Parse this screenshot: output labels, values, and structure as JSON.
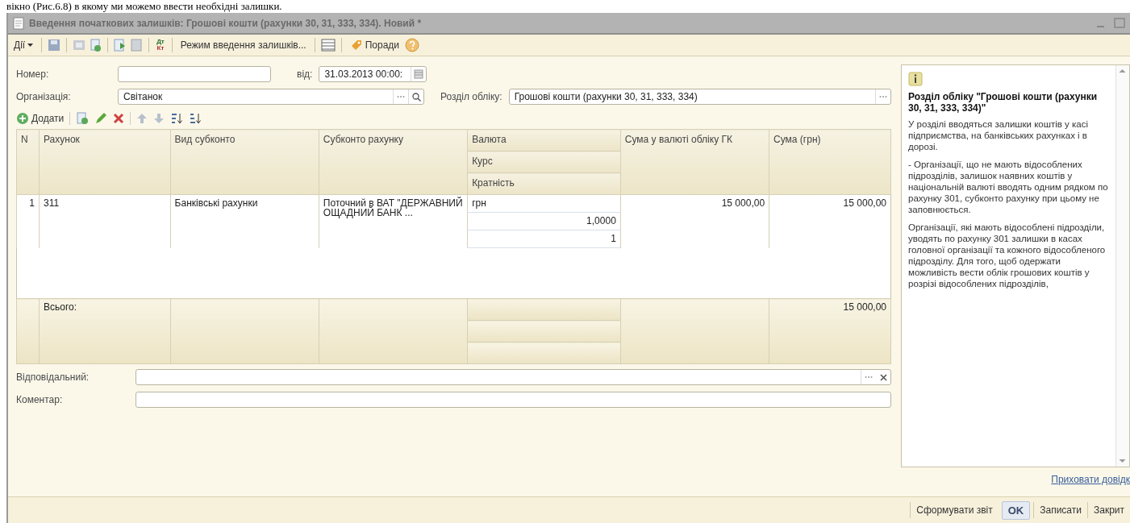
{
  "caption_text": "вікно (Рис.6.8) в якому ми можемо ввести необхідні залишки.",
  "window": {
    "title": "Введення початкових залишків: Грошові кошти (рахунки 30, 31, 333, 334). Новий *"
  },
  "toolbar": {
    "actions_menu": "Дії",
    "debit_credit": {
      "top": "Дт",
      "bottom": "Кт"
    },
    "mode_button": "Режим введення залишків...",
    "tips_button": "Поради"
  },
  "form": {
    "number": {
      "label": "Номер:"
    },
    "date": {
      "label": "від:",
      "value": "31.03.2013 00:00:"
    },
    "organization": {
      "label": "Організація:",
      "value": "Світанок"
    },
    "section": {
      "label": "Розділ обліку:",
      "value": "Грошові кошти (рахунки 30, 31, 333, 334)"
    },
    "add_button": "Додати",
    "table": {
      "columns": [
        {
          "label": "N"
        },
        {
          "label": "Рахунок"
        },
        {
          "label": "Вид субконто"
        },
        {
          "label": "Субконто рахунку"
        },
        {
          "label": "Валюта",
          "sublabels": [
            "Курс",
            "Кратність"
          ]
        },
        {
          "label": "Сума у валюті обліку ГК"
        },
        {
          "label": "Сума (грн)"
        }
      ],
      "rows": [
        {
          "n": "1",
          "account": "311",
          "subconto_kind": "Банківські рахунки",
          "subconto": "Поточний в ВАТ \"ДЕРЖАВНИЙ ОЩАДНИЙ БАНК ...",
          "currency": "грн",
          "rate": "1,0000",
          "multiplicity": "1",
          "amount_gk": "15 000,00",
          "amount_uah": "15 000,00"
        }
      ],
      "totals": {
        "label": "Всього:",
        "amount_uah": "15 000,00"
      }
    },
    "responsible": {
      "label": "Відповідальний:"
    },
    "comment": {
      "label": "Коментар:"
    }
  },
  "help": {
    "title": "Розділ обліку \"Грошові кошти (рахунки 30, 31, 333, 334)\"",
    "paragraphs": [
      "У розділі вводяться залишки коштів у касі підприємства, на банківських рахунках і в дорозі.",
      "- Організації, що не мають відособлених підрозділів, залишок наявних коштів у національній валюті вводять одним рядком по рахунку 301, субконто рахунку при цьому не заповнюється.",
      "Організації, які мають відособлені підрозділи, уводять по рахунку 301 залишки в касах головної організації та кожного відособленого підрозділу. Для того, щоб одержати можливість вести облік грошових коштів у розрізі відособлених підрозділів,"
    ],
    "hide_link": "Приховати довідк"
  },
  "footer": {
    "buttons": [
      {
        "label": "Сформувати звіт",
        "kind": "plain"
      },
      {
        "label": "OK",
        "kind": "default"
      },
      {
        "label": "Записати",
        "kind": "plain"
      },
      {
        "label": "Закрит",
        "kind": "plain"
      }
    ]
  }
}
